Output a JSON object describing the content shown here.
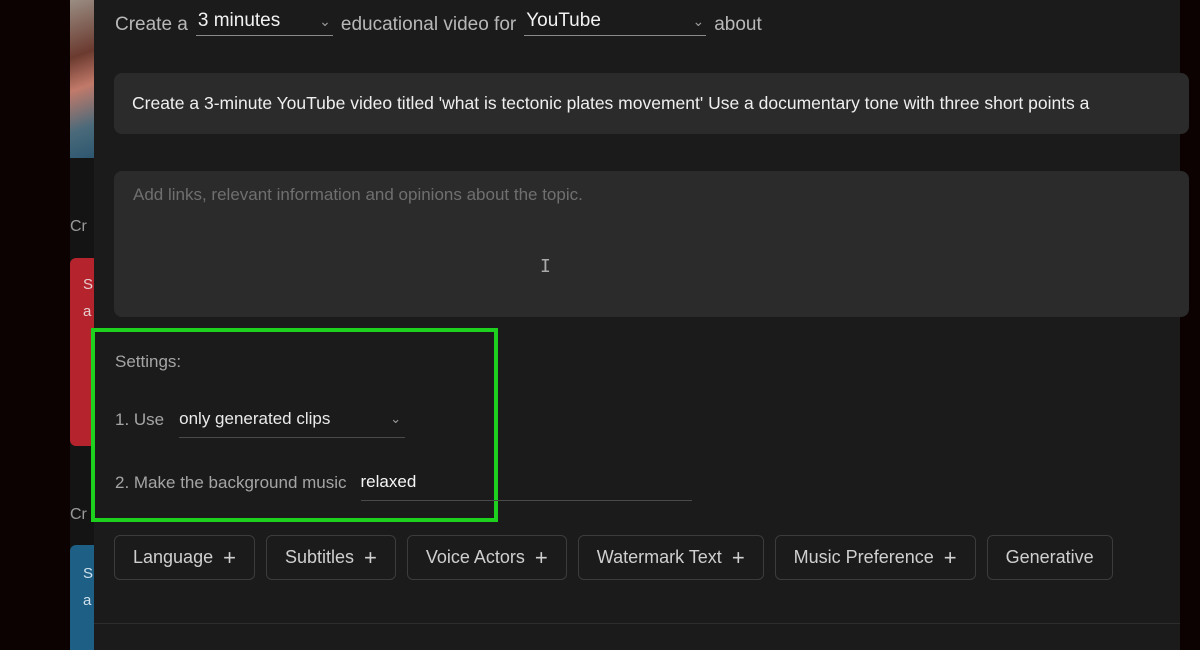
{
  "background": {
    "left_labels": [
      "Cr",
      "Cr"
    ],
    "red_card_letters": [
      "S",
      "a"
    ],
    "blue_card_letters": [
      "S",
      "a"
    ]
  },
  "header_line": {
    "prefix": "Create a",
    "duration_value": "3 minutes",
    "middle": "educational video for",
    "platform_value": "YouTube",
    "suffix": "about"
  },
  "prompt": {
    "text": "Create a 3-minute YouTube video titled 'what is tectonic plates movement' Use a documentary tone with three short points a"
  },
  "notes": {
    "placeholder": "Add links, relevant information and opinions about the topic.",
    "cursor_glyph": "I"
  },
  "settings": {
    "title": "Settings:",
    "use_label": "1. Use",
    "use_value": "only generated clips",
    "music_label": "2. Make the background music",
    "music_value": "relaxed",
    "highlight_color": "#1fd11f"
  },
  "chips": [
    {
      "label": "Language"
    },
    {
      "label": "Subtitles"
    },
    {
      "label": "Voice Actors"
    },
    {
      "label": "Watermark Text"
    },
    {
      "label": "Music Preference"
    },
    {
      "label": "Generative"
    }
  ],
  "chip_plus": "+",
  "chevron": "⌄"
}
